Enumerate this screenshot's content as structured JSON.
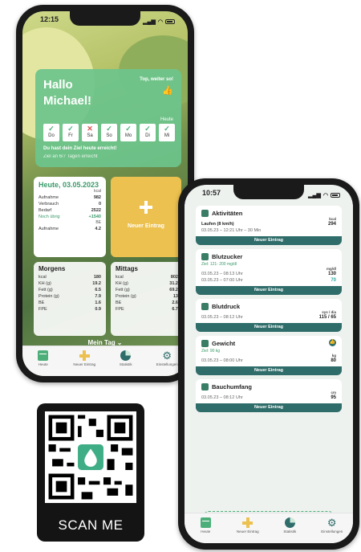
{
  "phone1": {
    "time": "12:15",
    "hello": {
      "title": "Hallo Michael!",
      "top_msg": "Top, weiter so!",
      "heute": "Heute",
      "days": [
        {
          "label": "Do",
          "mark": "✓"
        },
        {
          "label": "Fr",
          "mark": "✓"
        },
        {
          "label": "Sa",
          "mark": "✕"
        },
        {
          "label": "So",
          "mark": "✓"
        },
        {
          "label": "Mo",
          "mark": "✓"
        },
        {
          "label": "Di",
          "mark": "✓"
        },
        {
          "label": "Mi",
          "mark": "✓"
        }
      ],
      "goal_reached": "Du hast dein Ziel heute erreicht!",
      "goal_days": "Ziel an 6/7 Tagen erreicht"
    },
    "today": {
      "title": "Heute, 03.05.2023",
      "unit_kcal": "kcal",
      "unit_be": "BE",
      "rows": [
        {
          "label": "Aufnahme",
          "value": "982"
        },
        {
          "label": "Verbrauch",
          "value": "0"
        },
        {
          "label": "Bedarf",
          "value": "2522"
        },
        {
          "label": "Noch übrig",
          "value": "+1540"
        }
      ],
      "be_row": {
        "label": "Aufnahme",
        "value": "4.2"
      }
    },
    "new_entry": "Neuer Eintrag",
    "morgens": {
      "title": "Morgens",
      "rows": [
        {
          "label": "kcal",
          "value": "180"
        },
        {
          "label": "KH (g)",
          "value": "19.2"
        },
        {
          "label": "Fett (g)",
          "value": "6.5"
        },
        {
          "label": "Protein (g)",
          "value": "7.9"
        },
        {
          "label": "BE",
          "value": "1.6"
        },
        {
          "label": "FPE",
          "value": "0.9"
        }
      ]
    },
    "mittags": {
      "title": "Mittags",
      "rows": [
        {
          "label": "kcal",
          "value": "802"
        },
        {
          "label": "KH (g)",
          "value": "31.2"
        },
        {
          "label": "Fett (g)",
          "value": "69.2"
        },
        {
          "label": "Protein (g)",
          "value": "13"
        },
        {
          "label": "BE",
          "value": "2.6"
        },
        {
          "label": "FPE",
          "value": "6.7"
        }
      ]
    },
    "mein_tag": "Mein Tag ⌄",
    "tabs": [
      "Heute",
      "Neuer Eintrag",
      "Statistik",
      "Einstellungen"
    ]
  },
  "phone2": {
    "time": "10:57",
    "entries": [
      {
        "title": "Aktivitäten",
        "unit": "kcal",
        "rows": [
          {
            "label": "Laufen (8 km/h)",
            "value": "294",
            "bold_label": true
          },
          {
            "label": "03.05.23 – 12:21 Uhr – 30 Min",
            "value": ""
          }
        ],
        "button": "Neuer Eintrag"
      },
      {
        "title": "Blutzucker",
        "ziel": "Ziel: 121- 200 mg/dl",
        "unit": "mg/dl",
        "rows": [
          {
            "label": "03.05.23 – 08:13 Uhr",
            "value": "130"
          },
          {
            "label": "03.05.23 – 07:00 Uhr",
            "value": "70",
            "teal": true
          }
        ],
        "button": "Neuer Eintrag"
      },
      {
        "title": "Blutdruck",
        "unit": "sys / dia",
        "rows": [
          {
            "label": "03.05.23 – 08:12 Uhr",
            "value": "115 / 65"
          }
        ],
        "button": "Neuer Eintrag"
      },
      {
        "title": "Gewicht",
        "ziel": "Ziel: 90 kg",
        "unit": "kg",
        "thumb": true,
        "rows": [
          {
            "label": "03.05.23 – 08:00 Uhr",
            "value": "80"
          }
        ],
        "button": "Neuer Eintrag"
      },
      {
        "title": "Bauchumfang",
        "unit": "cm",
        "rows": [
          {
            "label": "03.05.23 – 08:12 Uhr",
            "value": "95"
          }
        ],
        "button": "Neuer Eintrag"
      }
    ],
    "tabs": [
      "Heute",
      "Neuer Eintrag",
      "Statistik",
      "Einstellungen"
    ]
  },
  "qr": {
    "label": "SCAN ME"
  }
}
